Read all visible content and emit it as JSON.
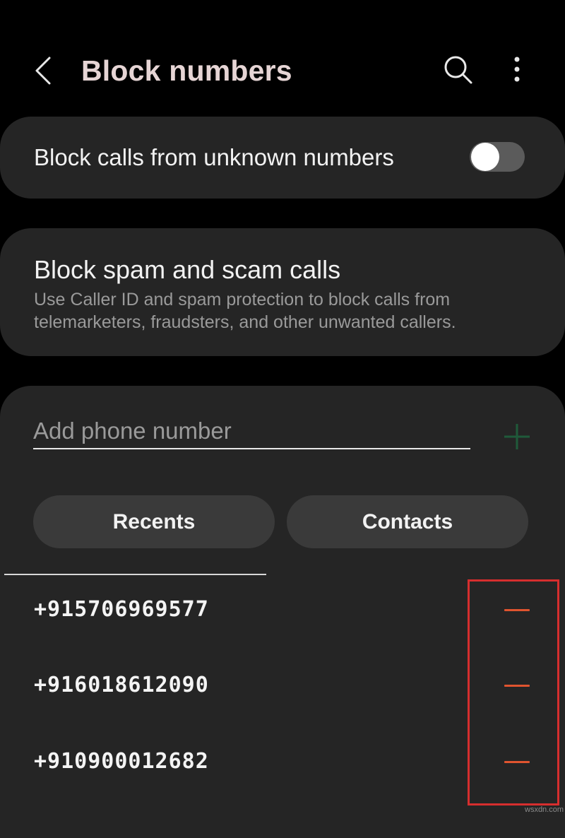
{
  "header": {
    "title": "Block numbers",
    "back_icon": "chevron-left-icon",
    "search_icon": "search-icon",
    "more_icon": "more-vertical-icon"
  },
  "block_unknown": {
    "label": "Block calls from unknown numbers",
    "enabled": false
  },
  "block_spam": {
    "title": "Block spam and scam calls",
    "description": "Use Caller ID and spam protection to block calls from telemarketers, fraudsters, and other unwanted callers."
  },
  "add_number": {
    "placeholder": "Add phone number",
    "add_icon": "plus-icon"
  },
  "buttons": {
    "recents": "Recents",
    "contacts": "Contacts"
  },
  "blocked_numbers": [
    {
      "number": "+915706969577",
      "remove_icon": "minus-icon"
    },
    {
      "number": "+916018612090",
      "remove_icon": "minus-icon"
    },
    {
      "number": "+910900012682",
      "remove_icon": "minus-icon"
    }
  ],
  "watermark": "wsxdn.com",
  "colors": {
    "background": "#000000",
    "card": "#252525",
    "title_text": "#e6d5d5",
    "secondary_text": "#9a9a9a",
    "remove_accent": "#e0542f",
    "add_accent": "#1f5a3a",
    "highlight": "#d62e2e"
  }
}
